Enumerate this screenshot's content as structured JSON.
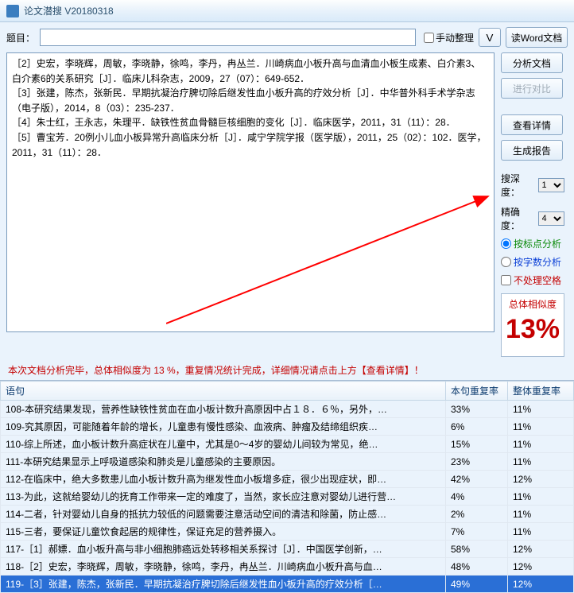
{
  "window": {
    "title": "论文潜搜 V20180318"
  },
  "top": {
    "topic_label": "题目：",
    "topic_value": "",
    "manual_chk": "手动整理",
    "v_btn": "V",
    "read_btn": "读Word文档"
  },
  "side": {
    "analyze": "分析文档",
    "compare": "进行对比",
    "detail": "查看详情",
    "report": "生成报告",
    "depth_label": "搜深度：",
    "depth_val": "1",
    "precision_label": "精确度：",
    "precision_val": "4",
    "radio_punct": "按标点分析",
    "radio_count": "按字数分析",
    "chk_nospace": "不处理空格",
    "score_label": "总体相似度",
    "score_pct": "13%"
  },
  "refs": [
    "［2］史宏，李晓辉，周敏，李晓静，徐鸣，李丹，冉丛兰．川崎病血小板升高与血清血小板生成素、白介素3、白介素6的关系研究［J］．临床儿科杂志，2009，27（07）：649-652．",
    "［3］张建，陈杰，张新民．早期抗凝治疗脾切除后继发性血小板升高的疗效分析［J］．中华普外科手术学杂志（电子版），2014，8（03）：235-237．",
    "［4］朱士红，王永志，朱理平．缺铁性贫血骨髓巨核细胞的变化［J］．临床医学，2011，31（11）：28．",
    "［5］曹宝芳．20例小儿血小板异常升高临床分析［J］．咸宁学院学报（医学版），2011，25（02）：102．医学，2011，31（11）：28．"
  ],
  "status": "本次文档分析完毕，总体相似度为 13 %，重复情况统计完成，详细情况请点击上方【查看详情】！",
  "table": {
    "h1": "语句",
    "h2": "本句重复率",
    "h3": "整体重复率",
    "rows": [
      {
        "s": "108-本研究结果发现，营养性缺铁性贫血在血小板计数升高原因中占１８．６％，另外，…",
        "r1": "33%",
        "r2": "11%"
      },
      {
        "s": "109-究其原因，可能随着年龄的增长，儿童患有慢性感染、血液病、肿瘤及结缔组织疾…",
        "r1": "6%",
        "r2": "11%"
      },
      {
        "s": "110-综上所述，血小板计数升高症状在儿童中，尤其是0～4岁的婴幼儿间较为常见，绝…",
        "r1": "15%",
        "r2": "11%"
      },
      {
        "s": "111-本研究结果显示上呼吸道感染和肺炎是儿童感染的主要原因。",
        "r1": "23%",
        "r2": "11%"
      },
      {
        "s": "112-在临床中，绝大多数患儿血小板计数升高为继发性血小板增多症，很少出现症状，即…",
        "r1": "42%",
        "r2": "12%"
      },
      {
        "s": "113-为此，这就给婴幼儿的抚育工作带来一定的难度了，当然，家长应注意对婴幼儿进行营…",
        "r1": "4%",
        "r2": "11%"
      },
      {
        "s": "114-二者，针对婴幼儿自身的抵抗力较低的问题需要注意活动空间的清洁和除菌，防止感…",
        "r1": "2%",
        "r2": "11%"
      },
      {
        "s": "115-三者，要保证儿童饮食起居的规律性，保证充足的营养摄入。",
        "r1": "7%",
        "r2": "11%"
      },
      {
        "s": "117-［1］郝嫖．血小板升高与非小细胞肺癌远处转移相关系探讨［J］．中国医学创新，…",
        "r1": "58%",
        "r2": "12%"
      },
      {
        "s": "118-［2］史宏，李晓辉，周敏，李晓静，徐鸣，李丹，冉丛兰．川崎病血小板升高与血…",
        "r1": "48%",
        "r2": "12%"
      },
      {
        "s": "119-［3］张建，陈杰，张新民．早期抗凝治疗脾切除后继发性血小板升高的疗效分析［…",
        "r1": "49%",
        "r2": "12%",
        "sel": true
      }
    ]
  }
}
